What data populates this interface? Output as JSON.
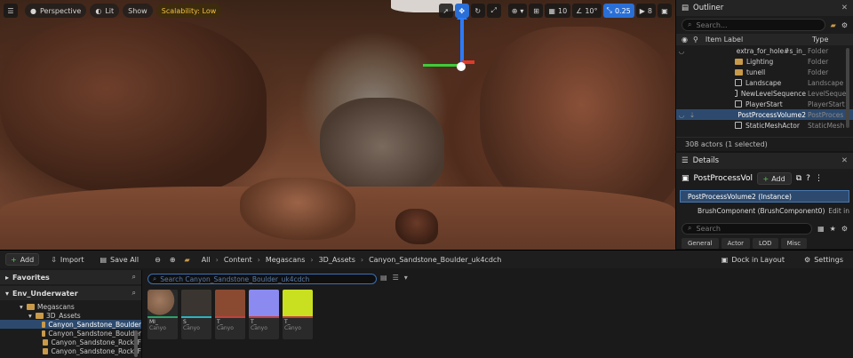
{
  "viewport": {
    "menu_icon": "hamburger-icon",
    "perspective_label": "Perspective",
    "lit_label": "Lit",
    "show_label": "Show",
    "scalability_label": "Scalability: Low",
    "grid_snap_value": "10",
    "rotation_snap_value": "10°",
    "scale_snap_value": "0.25",
    "camera_speed_value": "8"
  },
  "outliner": {
    "title": "Outliner",
    "search_placeholder": "Search...",
    "col_label": "Item Label",
    "col_type": "Type",
    "rows": [
      {
        "label": "extra_for_hole#s_in_er",
        "type": "Folder",
        "kind": "folder"
      },
      {
        "label": "Lighting",
        "type": "Folder",
        "kind": "folder"
      },
      {
        "label": "tunell",
        "type": "Folder",
        "kind": "folder"
      },
      {
        "label": "Landscape",
        "type": "Landscape",
        "kind": "actor"
      },
      {
        "label": "NewLevelSequence",
        "type": "LevelSeque",
        "kind": "actor"
      },
      {
        "label": "PlayerStart",
        "type": "PlayerStart",
        "kind": "actor"
      },
      {
        "label": "PostProcessVolume2",
        "type": "PostProces",
        "kind": "actor"
      },
      {
        "label": "StaticMeshActor",
        "type": "StaticMesh",
        "kind": "actor"
      }
    ],
    "footer": "308 actors (1 selected)"
  },
  "details": {
    "title": "Details",
    "object_name": "PostProcessVolu",
    "add_label": "Add",
    "instance_label": "PostProcessVolume2 (Instance)",
    "component_label": "BrushComponent (BrushComponent0)",
    "edit_label": "Edit in",
    "search_placeholder": "Search",
    "tabs": [
      "General",
      "Actor",
      "LOD",
      "Misc"
    ]
  },
  "content_browser": {
    "add_label": "Add",
    "import_label": "Import",
    "save_all_label": "Save All",
    "breadcrumbs": [
      "All",
      "Content",
      "Megascans",
      "3D_Assets",
      "Canyon_Sandstone_Boulder_uk4cdch"
    ],
    "dock_label": "Dock in Layout",
    "settings_label": "Settings",
    "favorites_label": "Favorites",
    "project_label": "Env_Underwater",
    "tree": [
      {
        "label": "Megascans",
        "depth": 1
      },
      {
        "label": "3D_Assets",
        "depth": 2
      },
      {
        "label": "Canyon_Sandstone_Boulder",
        "depth": 3,
        "selected": true
      },
      {
        "label": "Canyon_Sandstone_Boulder",
        "depth": 3
      },
      {
        "label": "Canyon_Sandstone_Rock_F",
        "depth": 3
      },
      {
        "label": "Canyon_Sandstone_Rock_F",
        "depth": 3
      }
    ],
    "search_value": "Search Canyon_Sandstone_Boulder_uk4cdch",
    "assets": [
      {
        "t1": "MI_",
        "t2": "Canyo",
        "thumb": "#7a5a44",
        "bar": "#2aa36a"
      },
      {
        "t1": "S_",
        "t2": "Canyo",
        "thumb": "#3a3530",
        "bar": "#2ab3c0"
      },
      {
        "t1": "T_",
        "t2": "Canyo",
        "thumb": "#8a4a32",
        "bar": "#c04040"
      },
      {
        "t1": "T_",
        "t2": "Canyo",
        "thumb": "#8a8af0",
        "bar": "#c04040"
      },
      {
        "t1": "T_",
        "t2": "Canyo",
        "thumb": "#c8e020",
        "bar": "#c04040"
      }
    ]
  }
}
